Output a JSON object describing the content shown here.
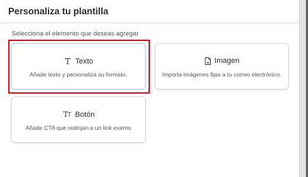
{
  "header": {
    "title": "Personaliza tu plantilla"
  },
  "main": {
    "subtitle": "Selecciona el elemento que deseas agregar",
    "cards": [
      {
        "id": "texto",
        "icon": "text-type-icon",
        "title": "Texto",
        "description": "Añade texto y personaliza su formato."
      },
      {
        "id": "imagen",
        "icon": "image-file-icon",
        "title": "Imagen",
        "description": "Importa imágenes fijas a tu correo electrónico."
      },
      {
        "id": "boton",
        "icon": "button-text-icon",
        "title": "Botón",
        "description": "Añade CTA que redirijan a un link exerno"
      }
    ],
    "highlight_color": "#e0101a"
  }
}
